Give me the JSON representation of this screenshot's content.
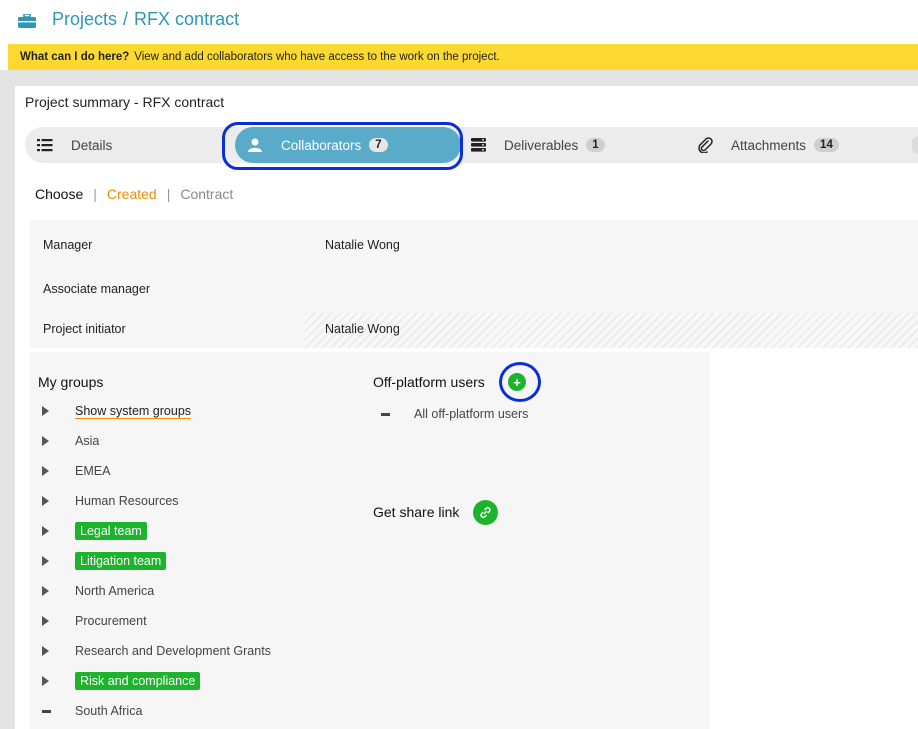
{
  "breadcrumb": {
    "icon": "briefcase-icon",
    "root": "Projects",
    "separator": "/",
    "current": "RFX contract"
  },
  "help": {
    "question": "What can I do here?",
    "text": "View and add collaborators who have access to the work on the project."
  },
  "project_title": "Project summary - RFX contract",
  "tabs": [
    {
      "label": "Details",
      "icon": "list-icon",
      "count": ""
    },
    {
      "label": "Collaborators",
      "icon": "user-icon",
      "count": "7",
      "active": true
    },
    {
      "label": "Deliverables",
      "icon": "server-icon",
      "count": "1"
    },
    {
      "label": "Attachments",
      "icon": "paperclip-icon",
      "count": "14"
    }
  ],
  "choose": {
    "label": "Choose",
    "separator": "|",
    "options": [
      "Created",
      "Contract"
    ],
    "selected": "Created"
  },
  "info": [
    {
      "key": "Manager",
      "value": "Natalie Wong"
    },
    {
      "key": "Associate manager",
      "value": ""
    },
    {
      "key": "Project initiator",
      "value": "Natalie Wong"
    }
  ],
  "groups": {
    "title": "My groups",
    "items": [
      {
        "label": "Show system groups",
        "style": "link",
        "state": "collapsed"
      },
      {
        "label": "Asia",
        "style": "plain",
        "state": "collapsed"
      },
      {
        "label": "EMEA",
        "style": "plain",
        "state": "collapsed"
      },
      {
        "label": "Human Resources",
        "style": "plain",
        "state": "collapsed"
      },
      {
        "label": "Legal team",
        "style": "tag",
        "state": "collapsed"
      },
      {
        "label": "Litigation team",
        "style": "tag",
        "state": "collapsed"
      },
      {
        "label": "North America",
        "style": "plain",
        "state": "collapsed"
      },
      {
        "label": "Procurement",
        "style": "plain",
        "state": "collapsed"
      },
      {
        "label": "Research and Development Grants",
        "style": "plain",
        "state": "collapsed"
      },
      {
        "label": "Risk and compliance",
        "style": "tag",
        "state": "collapsed"
      },
      {
        "label": "South Africa",
        "style": "plain",
        "state": "expanded"
      }
    ]
  },
  "off_platform": {
    "title": "Off-platform users",
    "add_label": "+",
    "all_label": "All off-platform users"
  },
  "share": {
    "title": "Get share link",
    "icon": "link-icon"
  },
  "colors": {
    "accent": "#5aaac9",
    "brand_blue": "#2f96b4",
    "help_yellow": "#fcd930",
    "green": "#1cb32d",
    "orange": "#f28c00",
    "highlight": "#0a2fd6"
  }
}
